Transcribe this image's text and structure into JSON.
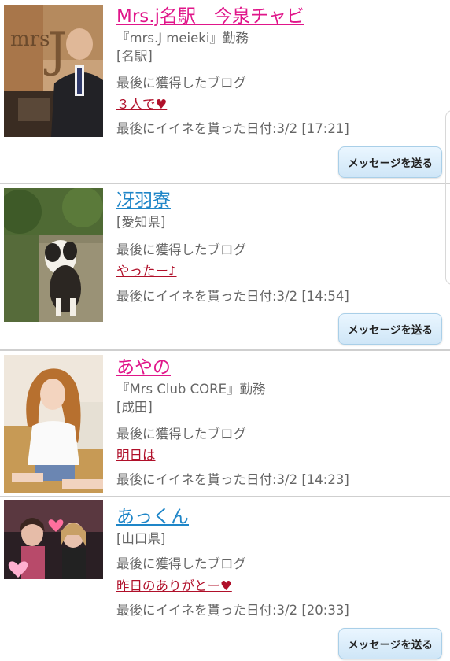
{
  "colors": {
    "name_pink": "#e0168a",
    "name_blue": "#1f86c8",
    "blog_link": "#b0102a",
    "text_gray": "#666666",
    "divider": "#cfcfcf",
    "button_bg": "#dcefff"
  },
  "labels": {
    "last_blog": "最後に獲得したブログ",
    "message_button": "メッセージを送る"
  },
  "users": [
    {
      "name": "Mrs.j名駅　今泉チャビ",
      "workplace": "『mrs.J meieki』勤務",
      "area": "[名駅]",
      "last_blog_title": "３人で♥",
      "last_like": "最後にイイネを貰った日付:3/2 [17:21]"
    },
    {
      "name": "冴羽寮",
      "area": "[愛知県]",
      "last_blog_title": "やったー♪",
      "last_like": "最後にイイネを貰った日付:3/2 [14:54]"
    },
    {
      "name": "あやの",
      "workplace": "『Mrs Club CORE』勤務",
      "area": "[成田]",
      "last_blog_title": "明日は",
      "last_like": "最後にイイネを貰った日付:3/2 [14:23]"
    },
    {
      "name": "あっくん",
      "area": "[山口県]",
      "last_blog_title": "昨日のありがとー♥",
      "last_like": "最後にイイネを貰った日付:3/2 [20:33]"
    }
  ]
}
